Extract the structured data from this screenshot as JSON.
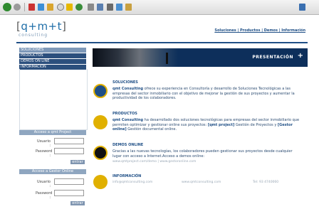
{
  "logo": {
    "main": "q+m+t",
    "sub": "consulting"
  },
  "topnav": {
    "label": "Soluciones | Productos | Demos | Información"
  },
  "sidebar": {
    "items": [
      {
        "label": "SOLUCIONES",
        "active": true
      },
      {
        "label": "PRODUCTOS",
        "active": false
      },
      {
        "label": "DEMOS ON LINE",
        "active": false
      },
      {
        "label": "INFORMACIÓN",
        "active": false
      }
    ]
  },
  "login1": {
    "title": "Acceso a qmt Project",
    "username_label": "Usuario :",
    "password_label": "Password :",
    "enter_label": "entrar"
  },
  "login2": {
    "title": "Acceso a Gestor Online",
    "username_label": "Usuario :",
    "password_label": "Password :",
    "enter_label": "entrar"
  },
  "banner": {
    "title": "PRESENTACIÓN",
    "plus": "+"
  },
  "sections": {
    "soluciones": {
      "title": "SOLUCIONES",
      "brand": "qmt Consulting",
      "text": " ofrece su experiencia en Consultoría y desarrollo de Soluciones Tecnológicas a las empresas del sector inmobiliario con el objetivo de mejorar la gestión de sus proyectos y aumentar la productividad de los colaboradores."
    },
    "productos": {
      "title": "PRODUCTOS",
      "brand": "qmt Consulting",
      "text1": " ha desarrollado dos soluciones tecnológicas para empresas del sector inmobiliario que permiten optimizar y gestionar online sus proyectos: ",
      "link1": "[qmt project]",
      "text2": " Gestión de Proyectos y ",
      "link2": "[Gestor online]",
      "text3": " Gestión documental online."
    },
    "demos": {
      "title": "DEMOS ONLINE",
      "text": "Gracias a las nuevas tecnologías, los colaboradores pueden gestionar sus proyectos desde cualquier lugar con acceso a Internet.Acceso a demos online:",
      "links": "www.qmtproject.com/demo  |  www.gestoronline.com"
    },
    "informacion": {
      "title": "INFORMACIÓN",
      "email": "info@qmtconsulting.com",
      "web": "www.qmtconsulting.com",
      "tel": "Tel: 93 4740060"
    }
  },
  "colors": {
    "navy": "#1f4f86",
    "banner": "#0d2f5b",
    "sidebar": "#2b4f7d",
    "active": "#7d98b8"
  },
  "icons": [
    "back-icon",
    "forward-icon",
    "stop-icon",
    "refresh-icon",
    "home-icon",
    "search-icon",
    "favorites-icon",
    "history-icon",
    "mail-icon",
    "print-icon",
    "edit-icon"
  ]
}
